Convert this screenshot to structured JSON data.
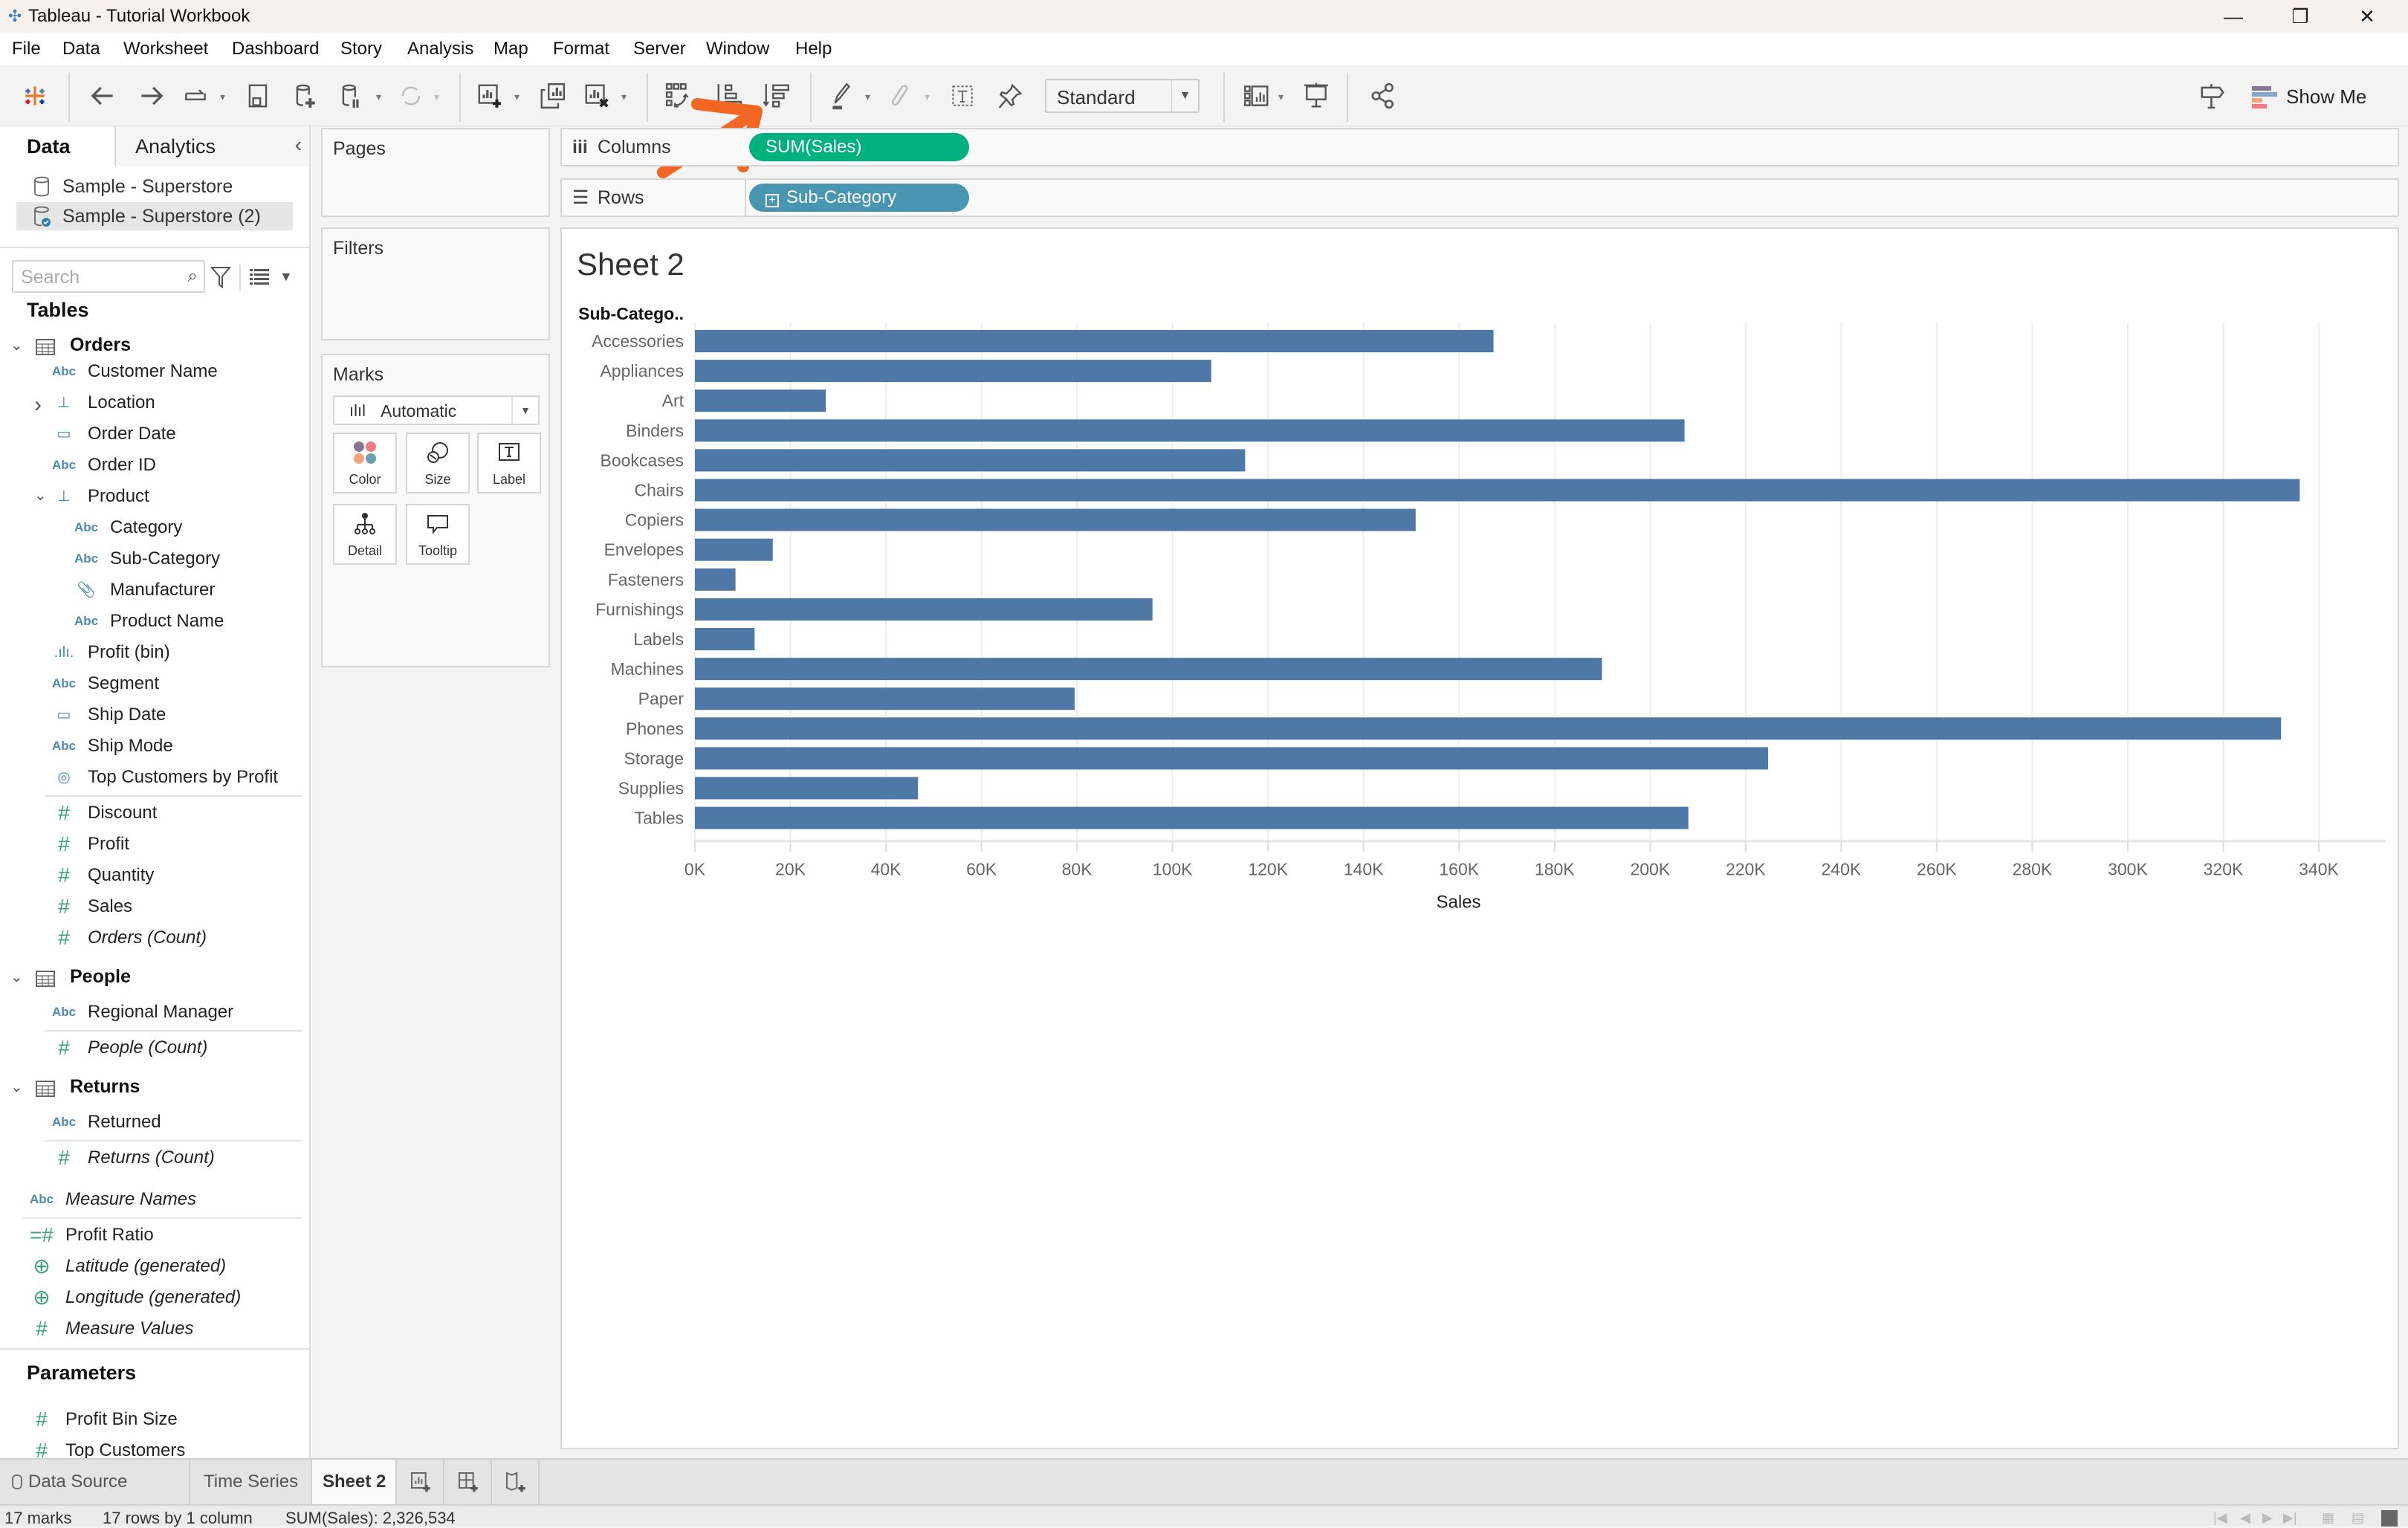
{
  "window": {
    "title": "Tableau - Tutorial Workbook",
    "controls": [
      "minimize",
      "restore",
      "close"
    ]
  },
  "menu": [
    "File",
    "Data",
    "Worksheet",
    "Dashboard",
    "Story",
    "Analysis",
    "Map",
    "Format",
    "Server",
    "Window",
    "Help"
  ],
  "toolbar": {
    "fit_select": "Standard",
    "show_me_label": "Show Me",
    "annotation": "orange arrow pointing to sort-descending button"
  },
  "data_pane": {
    "tabs": [
      "Data",
      "Analytics"
    ],
    "data_sources": [
      {
        "label": "Sample - Superstore",
        "selected": false
      },
      {
        "label": "Sample - Superstore (2)",
        "selected": true
      }
    ],
    "search_placeholder": "Search",
    "tables_heading": "Tables",
    "tables": [
      {
        "name": "Orders",
        "fields": [
          {
            "label": "Customer Name",
            "type": "abc"
          },
          {
            "label": "Location",
            "type": "hierarchy",
            "collapsed": true
          },
          {
            "label": "Order Date",
            "type": "date"
          },
          {
            "label": "Order ID",
            "type": "abc"
          },
          {
            "label": "Product",
            "type": "hierarchy",
            "collapsed": false
          },
          {
            "label": "Category",
            "type": "abc",
            "indent": 1
          },
          {
            "label": "Sub-Category",
            "type": "abc",
            "indent": 1
          },
          {
            "label": "Manufacturer",
            "type": "group",
            "indent": 1
          },
          {
            "label": "Product Name",
            "type": "abc",
            "indent": 1
          },
          {
            "label": "Profit (bin)",
            "type": "bin"
          },
          {
            "label": "Segment",
            "type": "abc"
          },
          {
            "label": "Ship Date",
            "type": "date"
          },
          {
            "label": "Ship Mode",
            "type": "abc"
          },
          {
            "label": "Top Customers by Profit",
            "type": "set"
          }
        ],
        "measures": [
          {
            "label": "Discount",
            "italic": false
          },
          {
            "label": "Profit",
            "italic": false
          },
          {
            "label": "Quantity",
            "italic": false
          },
          {
            "label": "Sales",
            "italic": false
          },
          {
            "label": "Orders (Count)",
            "italic": true
          }
        ]
      },
      {
        "name": "People",
        "fields": [
          {
            "label": "Regional Manager",
            "type": "abc"
          }
        ],
        "measures": [
          {
            "label": "People (Count)",
            "italic": true
          }
        ]
      },
      {
        "name": "Returns",
        "fields": [
          {
            "label": "Returned",
            "type": "abc"
          }
        ],
        "measures": [
          {
            "label": "Returns (Count)",
            "italic": true
          }
        ]
      }
    ],
    "global_fields": [
      {
        "label": "Measure Names",
        "type": "abc",
        "italic": true
      },
      {
        "label": "Profit Ratio",
        "type": "calc-measure",
        "italic": false
      },
      {
        "label": "Latitude (generated)",
        "type": "geo",
        "italic": true
      },
      {
        "label": "Longitude (generated)",
        "type": "geo",
        "italic": true
      },
      {
        "label": "Measure Values",
        "type": "measure",
        "italic": true
      }
    ],
    "parameters_heading": "Parameters",
    "parameters": [
      "Profit Bin Size",
      "Top Customers"
    ]
  },
  "cards": {
    "pages": "Pages",
    "filters": "Filters",
    "marks": "Marks",
    "mark_type": "Automatic",
    "mark_buttons": [
      "Color",
      "Size",
      "Label",
      "Detail",
      "Tooltip"
    ]
  },
  "shelves": {
    "columns_label": "Columns",
    "columns_pill": "SUM(Sales)",
    "rows_label": "Rows",
    "rows_pill": "Sub-Category"
  },
  "sheet": {
    "title": "Sheet 2"
  },
  "colors": {
    "bar": "#4e79a7",
    "measure_pill": "#00b180",
    "dimension_pill": "#4996b2",
    "annotation": "#f26522"
  },
  "chart_data": {
    "type": "bar",
    "orientation": "horizontal",
    "title": "Sheet 2",
    "row_header": "Sub-Catego..",
    "xlabel": "Sales",
    "ylabel": "Sub-Category",
    "categories": [
      "Accessories",
      "Appliances",
      "Art",
      "Binders",
      "Bookcases",
      "Chairs",
      "Copiers",
      "Envelopes",
      "Fasteners",
      "Furnishings",
      "Labels",
      "Machines",
      "Paper",
      "Phones",
      "Storage",
      "Supplies",
      "Tables"
    ],
    "values": [
      167200,
      108100,
      27400,
      207200,
      115200,
      336000,
      150900,
      16300,
      8500,
      95800,
      12500,
      189900,
      79500,
      332100,
      224700,
      46700,
      208000
    ],
    "xlim": [
      0,
      354000
    ],
    "xticks": [
      0,
      20000,
      40000,
      60000,
      80000,
      100000,
      120000,
      140000,
      160000,
      180000,
      200000,
      220000,
      240000,
      260000,
      280000,
      300000,
      320000,
      340000
    ],
    "xtick_labels": [
      "0K",
      "20K",
      "40K",
      "60K",
      "80K",
      "100K",
      "120K",
      "140K",
      "160K",
      "180K",
      "200K",
      "220K",
      "240K",
      "260K",
      "280K",
      "300K",
      "320K",
      "340K"
    ],
    "grid": true,
    "legend": "none"
  },
  "sheet_tabs": [
    {
      "label": "Data Source",
      "active": false
    },
    {
      "label": "Time Series",
      "active": false
    },
    {
      "label": "Sheet 2",
      "active": true
    }
  ],
  "status": {
    "marks": "17 marks",
    "dims": "17 rows by 1 column",
    "sum": "SUM(Sales): 2,326,534"
  }
}
